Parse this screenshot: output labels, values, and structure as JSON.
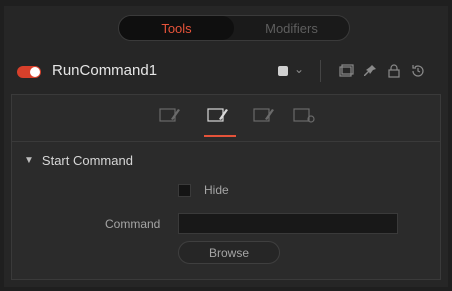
{
  "mode_toggle": {
    "tools_label": "Tools",
    "modifiers_label": "Modifiers",
    "active": "Tools"
  },
  "header": {
    "tool_name": "RunCommand1",
    "icons": [
      "color-swatch",
      "chevron-down-icon",
      "pip-icon",
      "pin-icon",
      "lock-icon",
      "reset-icon"
    ]
  },
  "tabs": [
    "controls-tab",
    "controls-tab-active",
    "controls-tab-3",
    "settings-tab"
  ],
  "section": {
    "title": "Start Command",
    "hide_label": "Hide",
    "hide_checked": false,
    "command_label": "Command",
    "command_value": "",
    "browse_label": "Browse"
  },
  "colors": {
    "accent": "#e5533a",
    "power_on": "#d8402b",
    "background": "#262626"
  }
}
